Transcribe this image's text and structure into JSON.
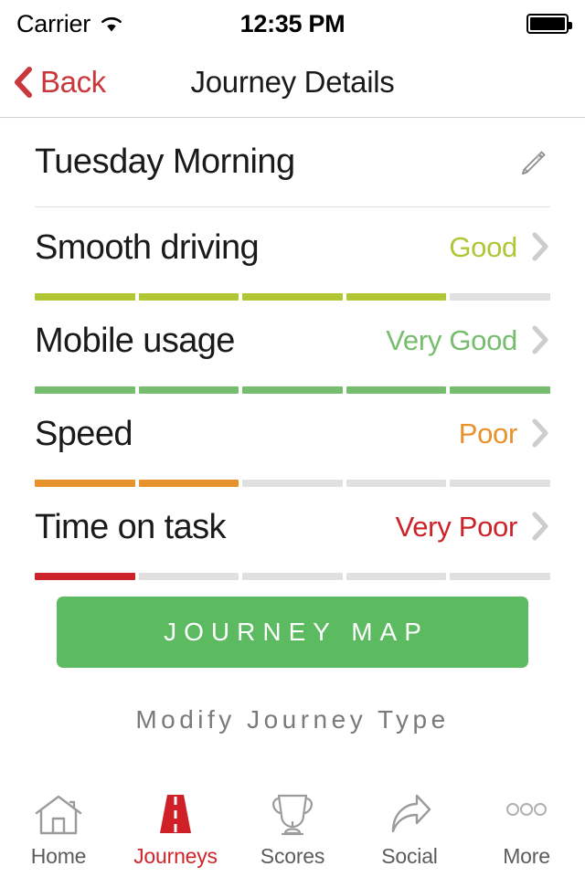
{
  "status_bar": {
    "carrier": "Carrier",
    "wifi_icon": "wifi-icon",
    "time": "12:35 PM",
    "battery_icon": "battery-full-icon"
  },
  "nav": {
    "back_label": "Back",
    "back_icon": "chevron-left-icon",
    "title": "Journey Details",
    "accent_color": "#c9383c"
  },
  "journey": {
    "name": "Tuesday Morning",
    "edit_icon": "pencil-icon"
  },
  "metrics": [
    {
      "label": "Smooth driving",
      "rating": "Good",
      "color": "#b0c636",
      "segments_total": 5,
      "segments_filled": 4,
      "chevron_icon": "chevron-right-icon"
    },
    {
      "label": "Mobile usage",
      "rating": "Very Good",
      "color": "#76bd6e",
      "segments_total": 5,
      "segments_filled": 5,
      "chevron_icon": "chevron-right-icon"
    },
    {
      "label": "Speed",
      "rating": "Poor",
      "color": "#e8922c",
      "segments_total": 5,
      "segments_filled": 2,
      "chevron_icon": "chevron-right-icon"
    },
    {
      "label": "Time on task",
      "rating": "Very Poor",
      "color": "#cc2229",
      "segments_total": 5,
      "segments_filled": 1,
      "chevron_icon": "chevron-right-icon"
    }
  ],
  "actions": {
    "map_button_label": "JOURNEY MAP",
    "map_button_color": "#5cba61",
    "modify_link_label": "Modify Journey Type"
  },
  "tabbar": {
    "items": [
      {
        "label": "Home",
        "icon": "home-icon",
        "active": false
      },
      {
        "label": "Journeys",
        "icon": "road-icon",
        "active": true
      },
      {
        "label": "Scores",
        "icon": "trophy-icon",
        "active": false
      },
      {
        "label": "Social",
        "icon": "share-icon",
        "active": false
      },
      {
        "label": "More",
        "icon": "ellipsis-icon",
        "active": false
      }
    ],
    "active_color": "#d0252b",
    "inactive_color": "#5c5c5c"
  }
}
